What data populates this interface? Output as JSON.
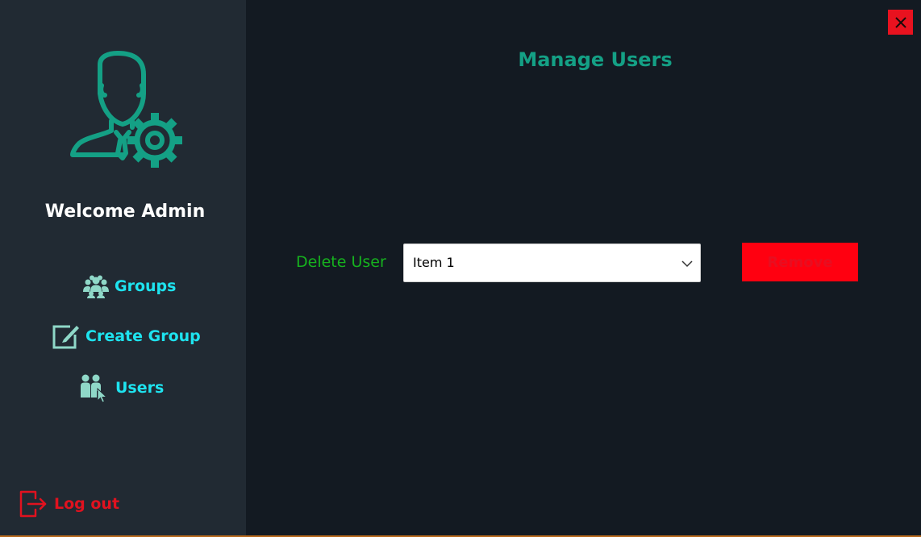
{
  "sidebar": {
    "welcome_text": "Welcome Admin",
    "nav": {
      "groups_label": "Groups",
      "create_group_label": "Create Group",
      "users_label": "Users"
    },
    "logout_label": "Log out"
  },
  "main": {
    "title": "Manage Users",
    "delete_label": "Delete User",
    "user_select": {
      "selected": "Item 1"
    },
    "remove_label": "Remove"
  },
  "icons": {
    "admin": "admin-user-gear-icon",
    "groups": "groups-icon",
    "create_group": "edit-icon",
    "users": "users-pointer-icon",
    "logout": "logout-icon",
    "close": "close-icon",
    "dropdown": "chevron-down-icon"
  },
  "colors": {
    "sidebar_bg": "#212a33",
    "main_bg": "#131a22",
    "accent_teal": "#14a085",
    "nav_cyan": "#1ee3ef",
    "label_green": "#16b11e",
    "danger_red": "#ff0010"
  }
}
